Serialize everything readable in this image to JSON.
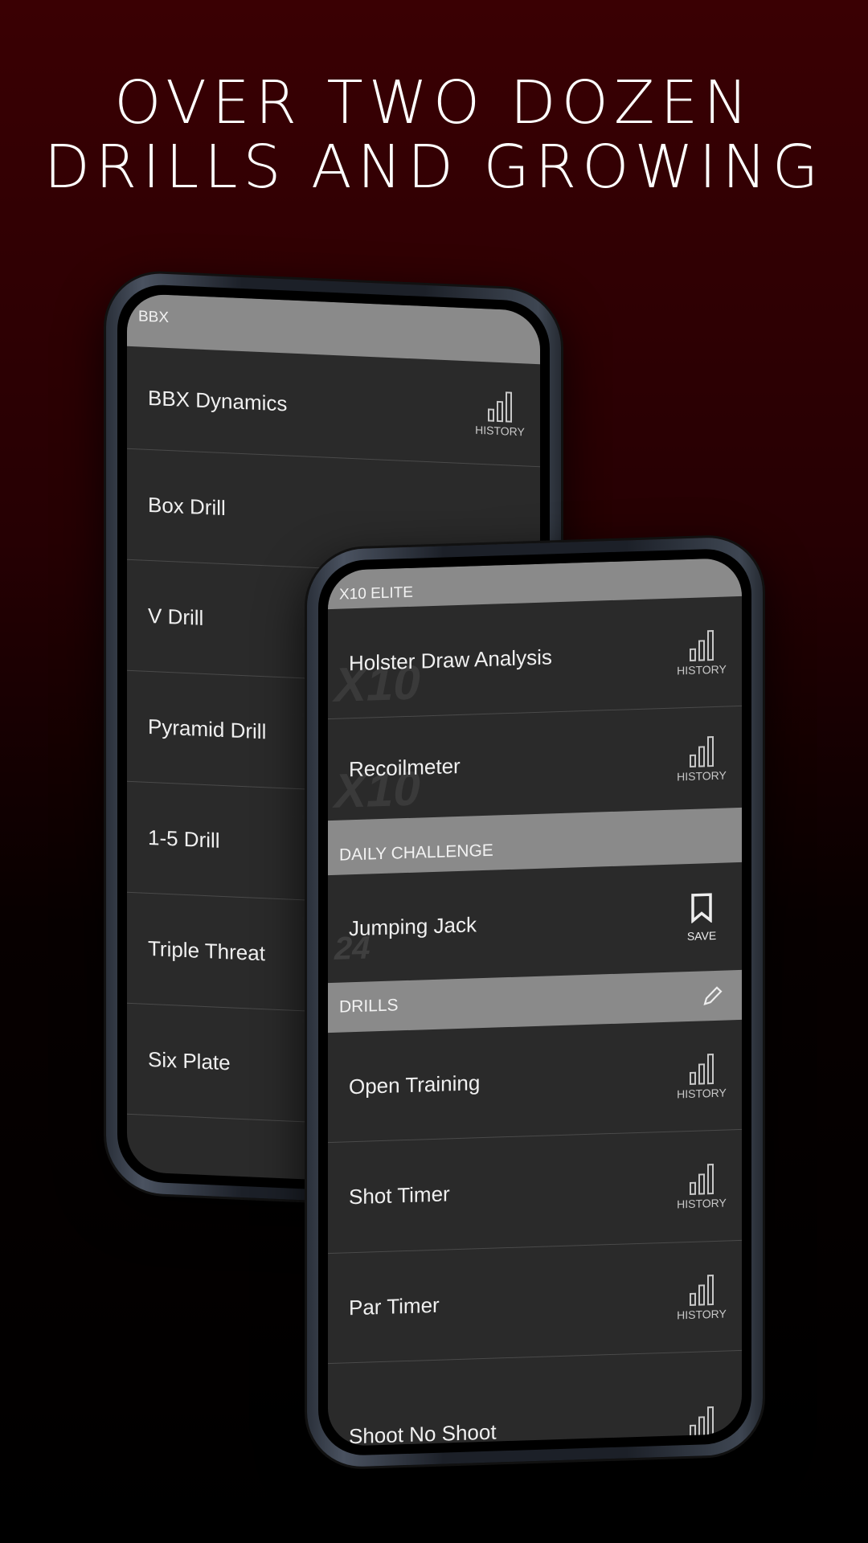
{
  "headline": {
    "line1": "OVER TWO DOZEN",
    "line2": "DRILLS AND GROWING"
  },
  "back_phone": {
    "section": "BBX",
    "items": [
      {
        "label": "BBX Dynamics",
        "action": "HISTORY"
      },
      {
        "label": "Box Drill"
      },
      {
        "label": "V Drill"
      },
      {
        "label": "Pyramid Drill"
      },
      {
        "label": "1-5 Drill"
      },
      {
        "label": "Triple Threat"
      },
      {
        "label": "Six Plate"
      }
    ]
  },
  "front_phone": {
    "elite": {
      "section": "X10 ELITE",
      "watermark": "X10",
      "items": [
        {
          "label": "Holster Draw Analysis",
          "action": "HISTORY"
        },
        {
          "label": "Recoilmeter",
          "action": "HISTORY"
        }
      ]
    },
    "daily": {
      "section": "DAILY CHALLENGE",
      "watermark": "24",
      "item": {
        "label": "Jumping Jack",
        "action": "SAVE"
      }
    },
    "drills": {
      "section": "DRILLS",
      "items": [
        {
          "label": "Open Training",
          "action": "HISTORY"
        },
        {
          "label": "Shot Timer",
          "action": "HISTORY"
        },
        {
          "label": "Par Timer",
          "action": "HISTORY"
        },
        {
          "label": "Shoot No Shoot",
          "action": "HISTORY"
        }
      ]
    }
  },
  "colors": {
    "header_bg": "#8a8a8a",
    "row_bg": "#2a2a2a",
    "background_top": "#3a0003"
  }
}
